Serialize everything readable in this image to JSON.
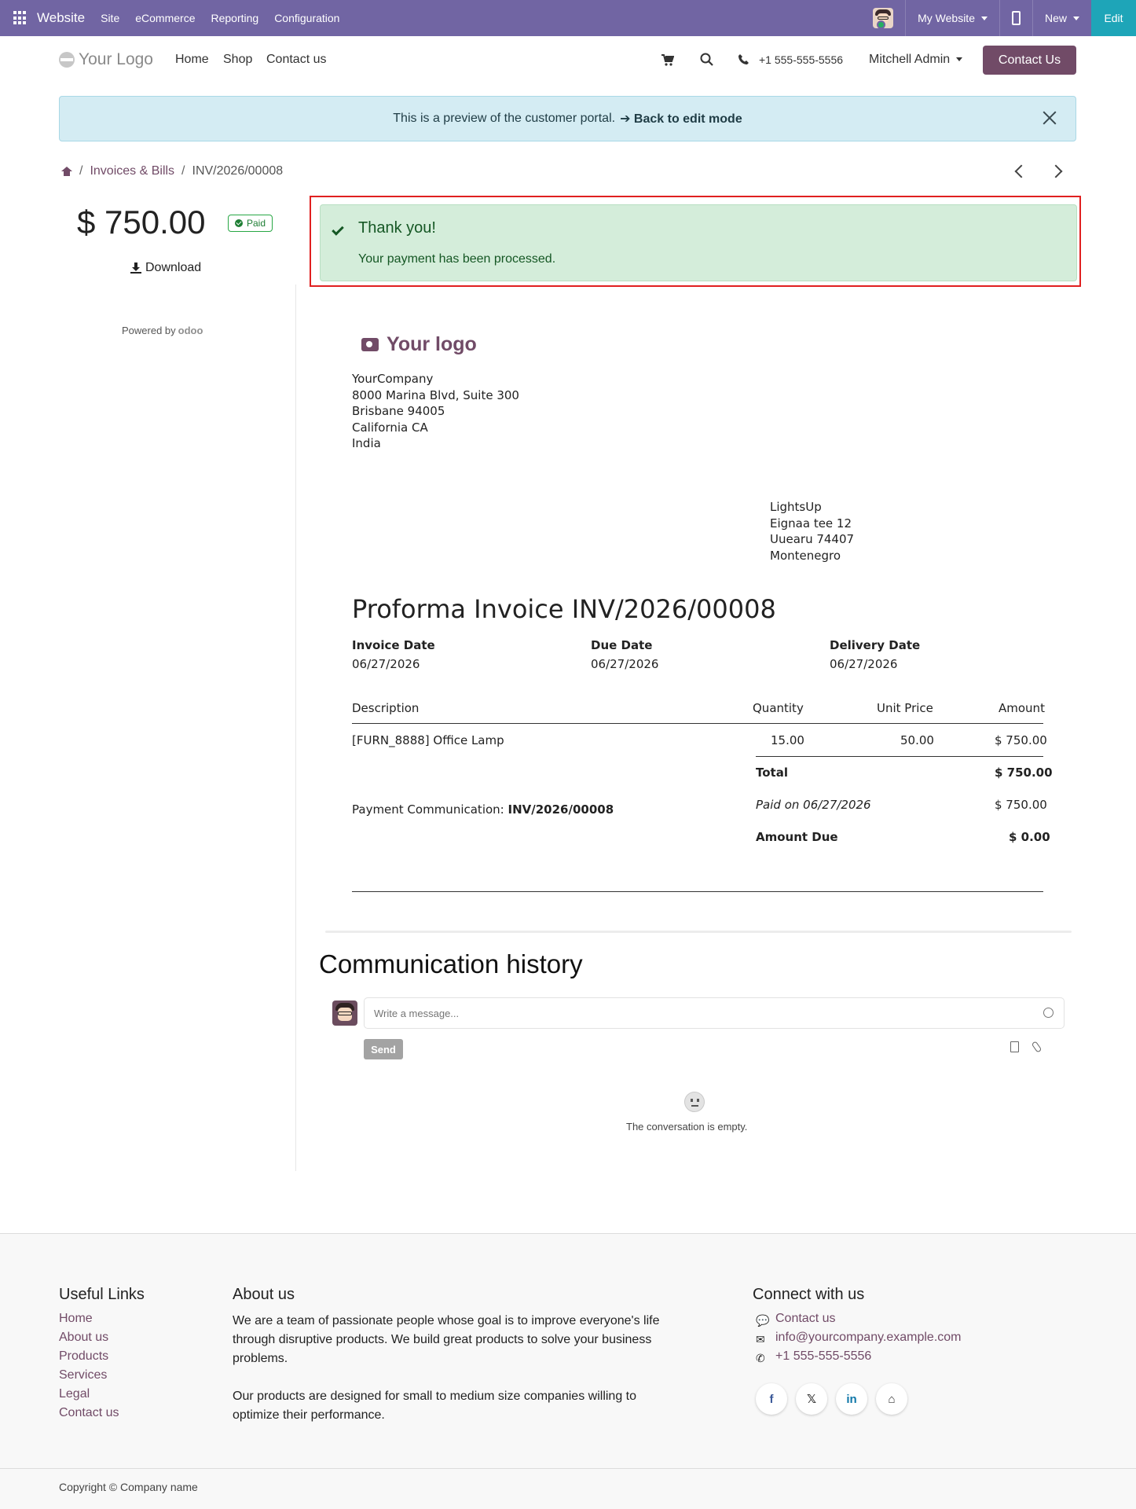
{
  "topbar": {
    "brand": "Website",
    "menus": [
      "Site",
      "eCommerce",
      "Reporting",
      "Configuration"
    ],
    "website_selector": "My Website",
    "new_label": "New",
    "edit_label": "Edit"
  },
  "header": {
    "logo_text": "Your Logo",
    "nav": [
      "Home",
      "Shop",
      "Contact us"
    ],
    "phone": "+1 555-555-5556",
    "user": "Mitchell Admin",
    "contact_button": "Contact Us"
  },
  "preview_alert": {
    "text": "This is a preview of the customer portal.",
    "link": "➔ Back to edit mode"
  },
  "breadcrumb": {
    "items": [
      "Invoices & Bills",
      "INV/2026/00008"
    ]
  },
  "sidebar": {
    "amount": "$ 750.00",
    "status": "Paid",
    "download": "Download",
    "powered_by": "Powered by",
    "powered_brand": "odoo"
  },
  "payment_alert": {
    "title": "Thank you!",
    "message": "Your payment has been processed."
  },
  "invoice": {
    "logo_text": "Your logo",
    "company_address": [
      "YourCompany",
      "8000 Marina Blvd, Suite 300",
      "Brisbane 94005",
      "California CA",
      "India"
    ],
    "customer_address": [
      "LightsUp",
      "Eignaa tee 12",
      "Uuearu 74407",
      "Montenegro"
    ],
    "title": "Proforma Invoice INV/2026/00008",
    "dates": [
      {
        "label": "Invoice Date",
        "value": "06/27/2026"
      },
      {
        "label": "Due Date",
        "value": "06/27/2026"
      },
      {
        "label": "Delivery Date",
        "value": "06/27/2026"
      }
    ],
    "columns": [
      "Description",
      "Quantity",
      "Unit Price",
      "Amount"
    ],
    "lines": [
      {
        "description": "[FURN_8888] Office Lamp",
        "quantity": "15.00",
        "unit_price": "50.00",
        "amount": "$ 750.00"
      }
    ],
    "total_label": "Total",
    "total_value": "$ 750.00",
    "payment_comm_label": "Payment Communication:",
    "payment_comm_value": "INV/2026/00008",
    "paid_on_label": "Paid on 06/27/2026",
    "paid_on_value": "$ 750.00",
    "amount_due_label": "Amount Due",
    "amount_due_value": "$ 0.00"
  },
  "communication": {
    "title": "Communication history",
    "placeholder": "Write a message...",
    "send": "Send",
    "empty": "The conversation is empty."
  },
  "footer": {
    "useful_links_title": "Useful Links",
    "useful_links": [
      "Home",
      "About us",
      "Products",
      "Services",
      "Legal",
      "Contact us"
    ],
    "about_title": "About us",
    "about_p1": "We are a team of passionate people whose goal is to improve everyone's life through disruptive products. We build great products to solve your business problems.",
    "about_p2": "Our products are designed for small to medium size companies willing to optimize their performance.",
    "connect_title": "Connect with us",
    "connect": [
      "Contact us",
      "info@yourcompany.example.com",
      "+1 555-555-5556"
    ],
    "social": [
      "f",
      "𝕏",
      "in",
      "⌂"
    ],
    "copyright": "Copyright © Company name"
  },
  "colors": {
    "topbar": "#7165a3",
    "brand": "#714b67",
    "edit": "#1ea5b8",
    "success_bg": "#d4edda",
    "info_bg": "#d4ecf3",
    "highlight": "#e02020"
  }
}
